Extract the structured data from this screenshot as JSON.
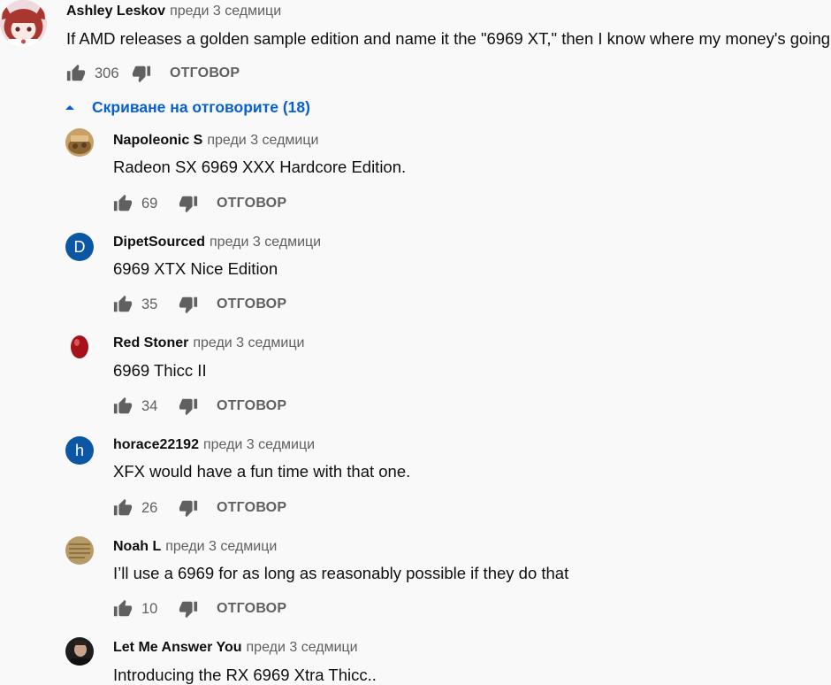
{
  "top_comment": {
    "author": "Ashley Leskov",
    "time": "преди 3 седмици",
    "text": "If AMD releases a golden sample edition and name it the \"6969 XT,\" then I know where my money's going.",
    "likes": "306",
    "reply_label": "ОТГОВОР",
    "avatar_icon": "cartoon-girl-avatar"
  },
  "toggle_replies": {
    "label": "Скриване на отговорите (18)",
    "color": "#065fd4"
  },
  "replies": [
    {
      "author": "Napoleonic S",
      "time": "преди 3 седмици",
      "text": "Radeon SX 6969 XXX Hardcore Edition.",
      "likes": "69",
      "reply_label": "ОТГОВОР",
      "avatar_icon": "painting-avatar"
    },
    {
      "author": "DipetSourced",
      "time": "преди 3 седмици",
      "text": "6969 XTX Nice Edition",
      "likes": "35",
      "reply_label": "ОТГОВОР",
      "avatar_letter": "D",
      "avatar_color": "#0b57a4"
    },
    {
      "author": "Red Stoner",
      "time": "преди 3 седмици",
      "text": "6969 Thicc II",
      "likes": "34",
      "reply_label": "ОТГОВОР",
      "avatar_icon": "red-stone-avatar"
    },
    {
      "author": "horace22192",
      "time": "преди 3 седмици",
      "text": "XFX would have a fun time with that one.",
      "likes": "26",
      "reply_label": "ОТГОВОР",
      "avatar_letter": "h",
      "avatar_color": "#0b57a4"
    },
    {
      "author": "Noah L",
      "time": "преди 3 седмици",
      "text": "I’ll use a 6969 for as long as reasonably possible if they do that",
      "likes": "10",
      "reply_label": "ОТГОВОР",
      "avatar_icon": "parchment-avatar"
    },
    {
      "author": "Let Me Answer You",
      "time": "преди 3 седмици",
      "text": "Introducing the RX 6969 Xtra Thicc..",
      "avatar_icon": "portrait-photo-avatar"
    }
  ]
}
